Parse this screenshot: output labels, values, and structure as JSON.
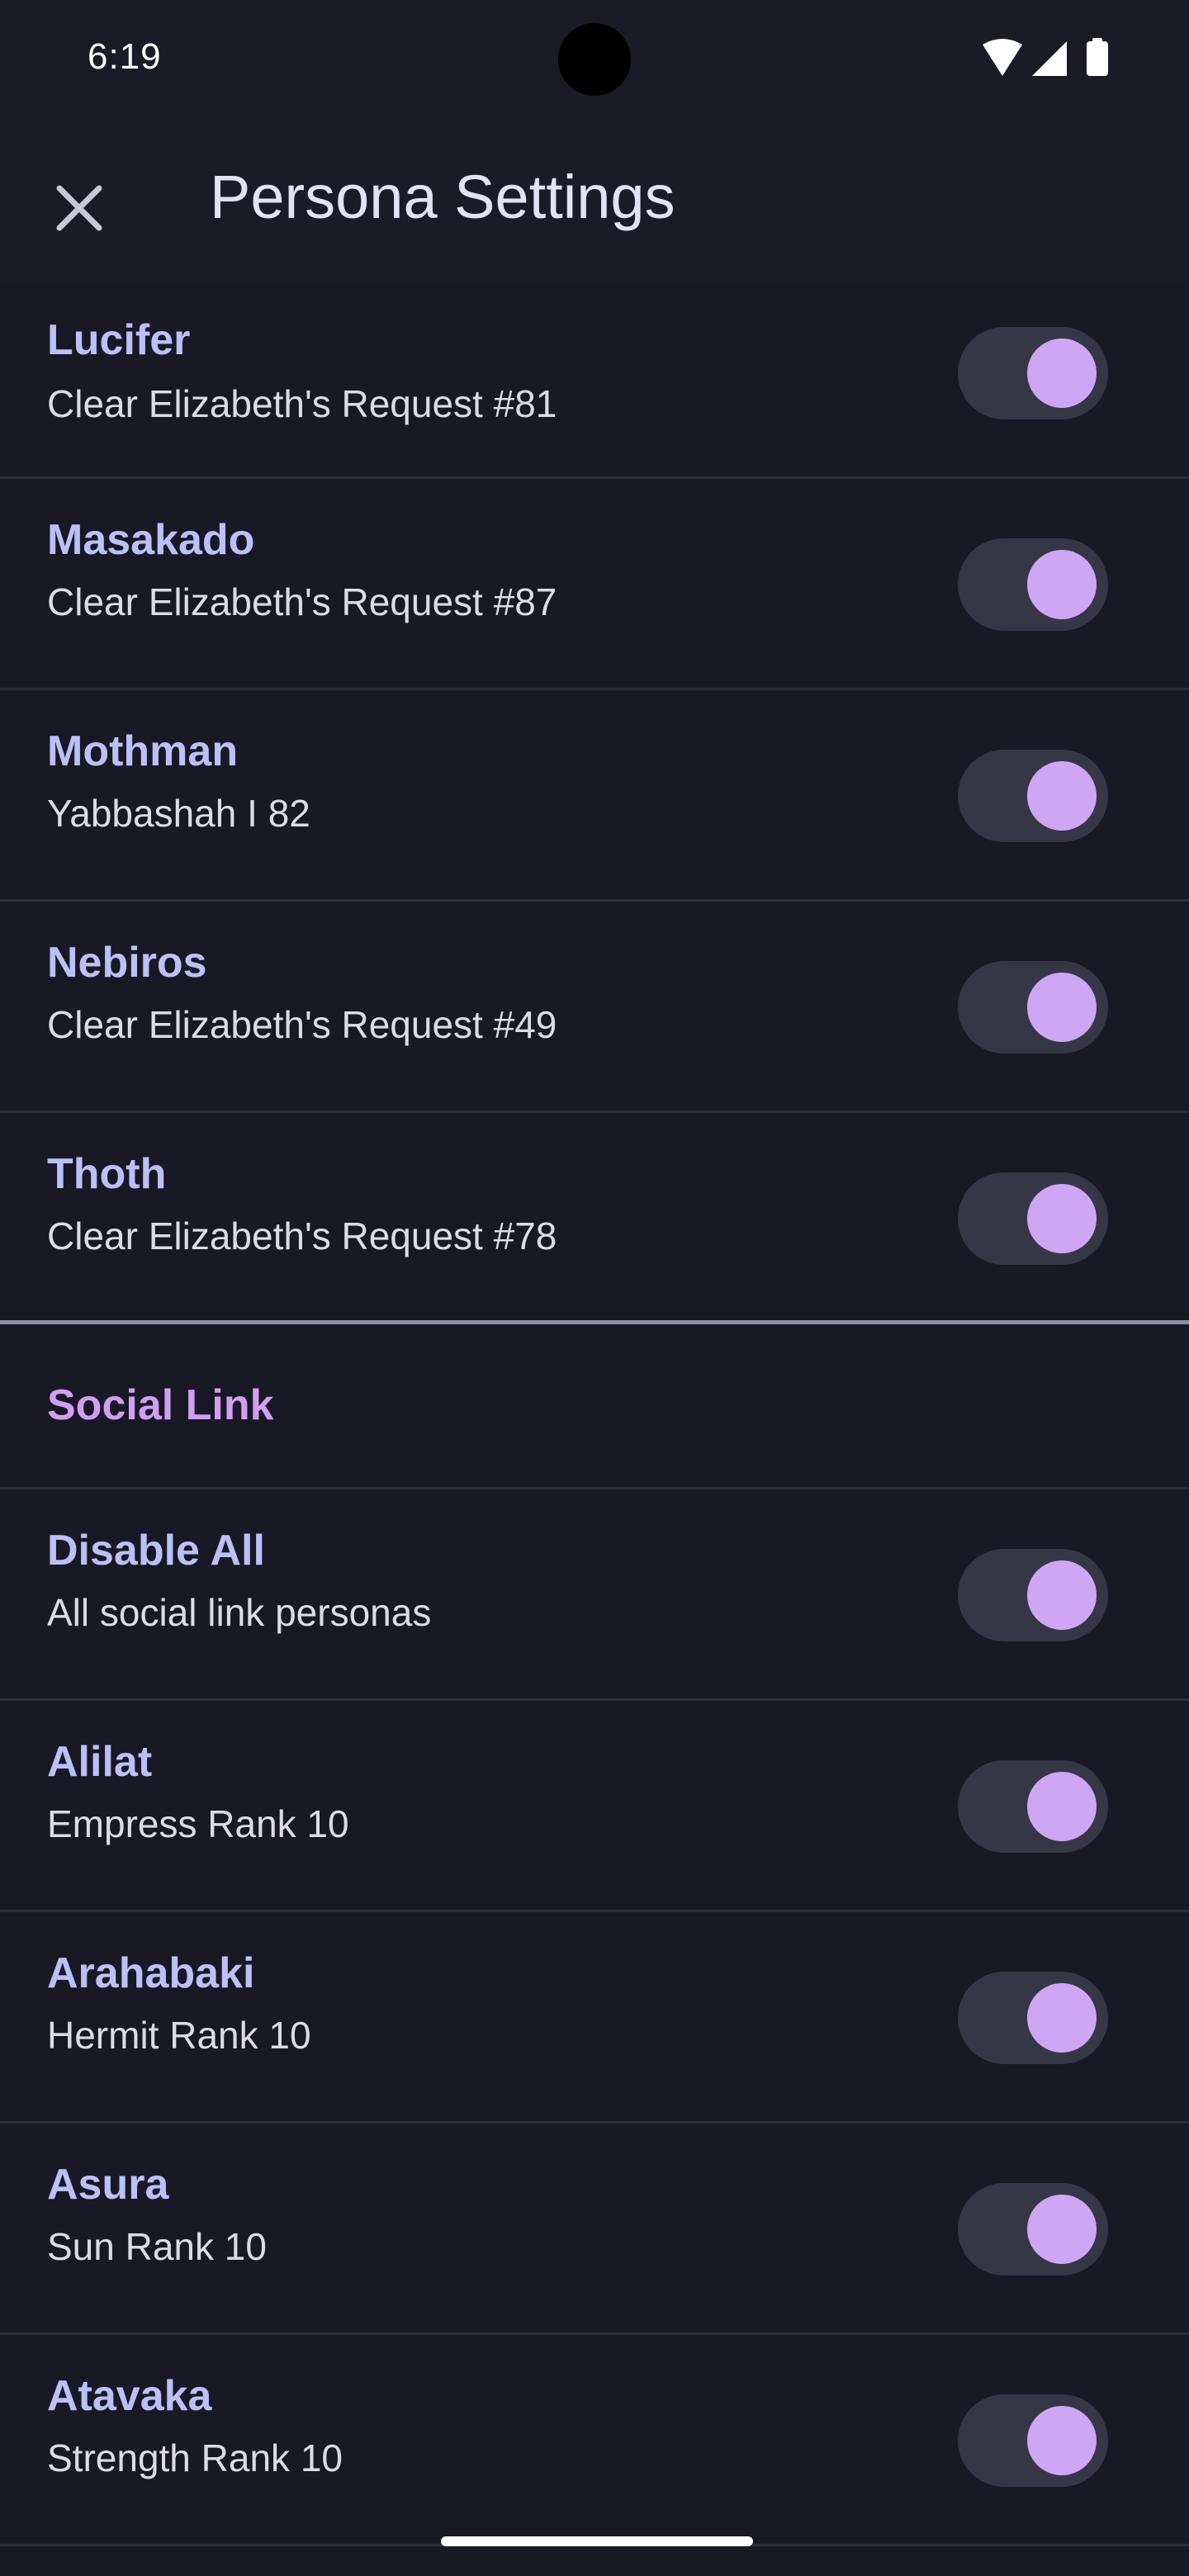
{
  "status_bar": {
    "time": "6:19",
    "icons": [
      "wifi-icon",
      "signal-icon",
      "battery-icon"
    ]
  },
  "app_bar": {
    "title": "Persona Settings",
    "close_icon": "close-icon"
  },
  "colors": {
    "background": "#181924",
    "title_text": "#bcc0f7",
    "section_text": "#d29ef2",
    "toggle_knob": "#cfa6f4",
    "toggle_track": "#363746"
  },
  "fusion_rows": [
    {
      "name": "Lucifer",
      "detail": "Clear Elizabeth's Request #81",
      "enabled": true
    },
    {
      "name": "Masakado",
      "detail": "Clear Elizabeth's Request #87",
      "enabled": true
    },
    {
      "name": "Mothman",
      "detail": "Yabbashah I 82",
      "enabled": true
    },
    {
      "name": "Nebiros",
      "detail": "Clear Elizabeth's Request #49",
      "enabled": true
    },
    {
      "name": "Thoth",
      "detail": "Clear Elizabeth's Request #78",
      "enabled": true
    }
  ],
  "social_link": {
    "section_title": "Social Link",
    "rows": [
      {
        "name": "Disable All",
        "detail": "All social link personas",
        "enabled": true
      },
      {
        "name": "Alilat",
        "detail": "Empress Rank 10",
        "enabled": true
      },
      {
        "name": "Arahabaki",
        "detail": "Hermit Rank 10",
        "enabled": true
      },
      {
        "name": "Asura",
        "detail": "Sun Rank 10",
        "enabled": true
      },
      {
        "name": "Atavaka",
        "detail": "Strength Rank 10",
        "enabled": true
      }
    ]
  }
}
